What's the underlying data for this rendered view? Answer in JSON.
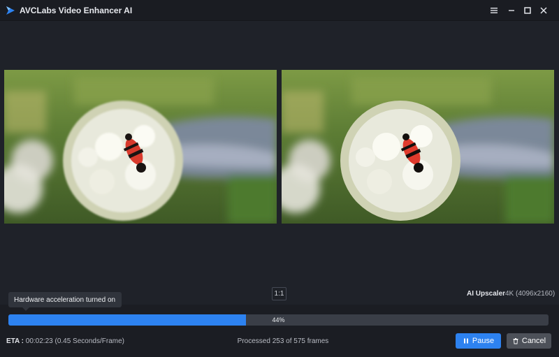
{
  "window": {
    "title": "AVCLabs Video Enhancer AI",
    "controls": [
      "menu-icon",
      "minimize-icon",
      "maximize-icon",
      "close-icon"
    ]
  },
  "viewer": {
    "ratio_label": "1:1",
    "upscaler_label": "AI Upscaler",
    "upscaler_value": "4K (4096x2160)"
  },
  "tooltip": {
    "text": "Hardware acceleration turned on"
  },
  "progress": {
    "percent": 44,
    "label": "44%"
  },
  "status": {
    "eta_label": "ETA :",
    "eta_value": "00:02:23 (0.45 Seconds/Frame)",
    "processed": "Processed 253 of 575 frames"
  },
  "actions": {
    "pause_label": "Pause",
    "pause_icon": "pause-icon",
    "cancel_label": "Cancel",
    "cancel_icon": "trash-icon"
  },
  "colors": {
    "accent": "#2d82f0",
    "background": "#1f2229",
    "track": "#3a3e47"
  }
}
